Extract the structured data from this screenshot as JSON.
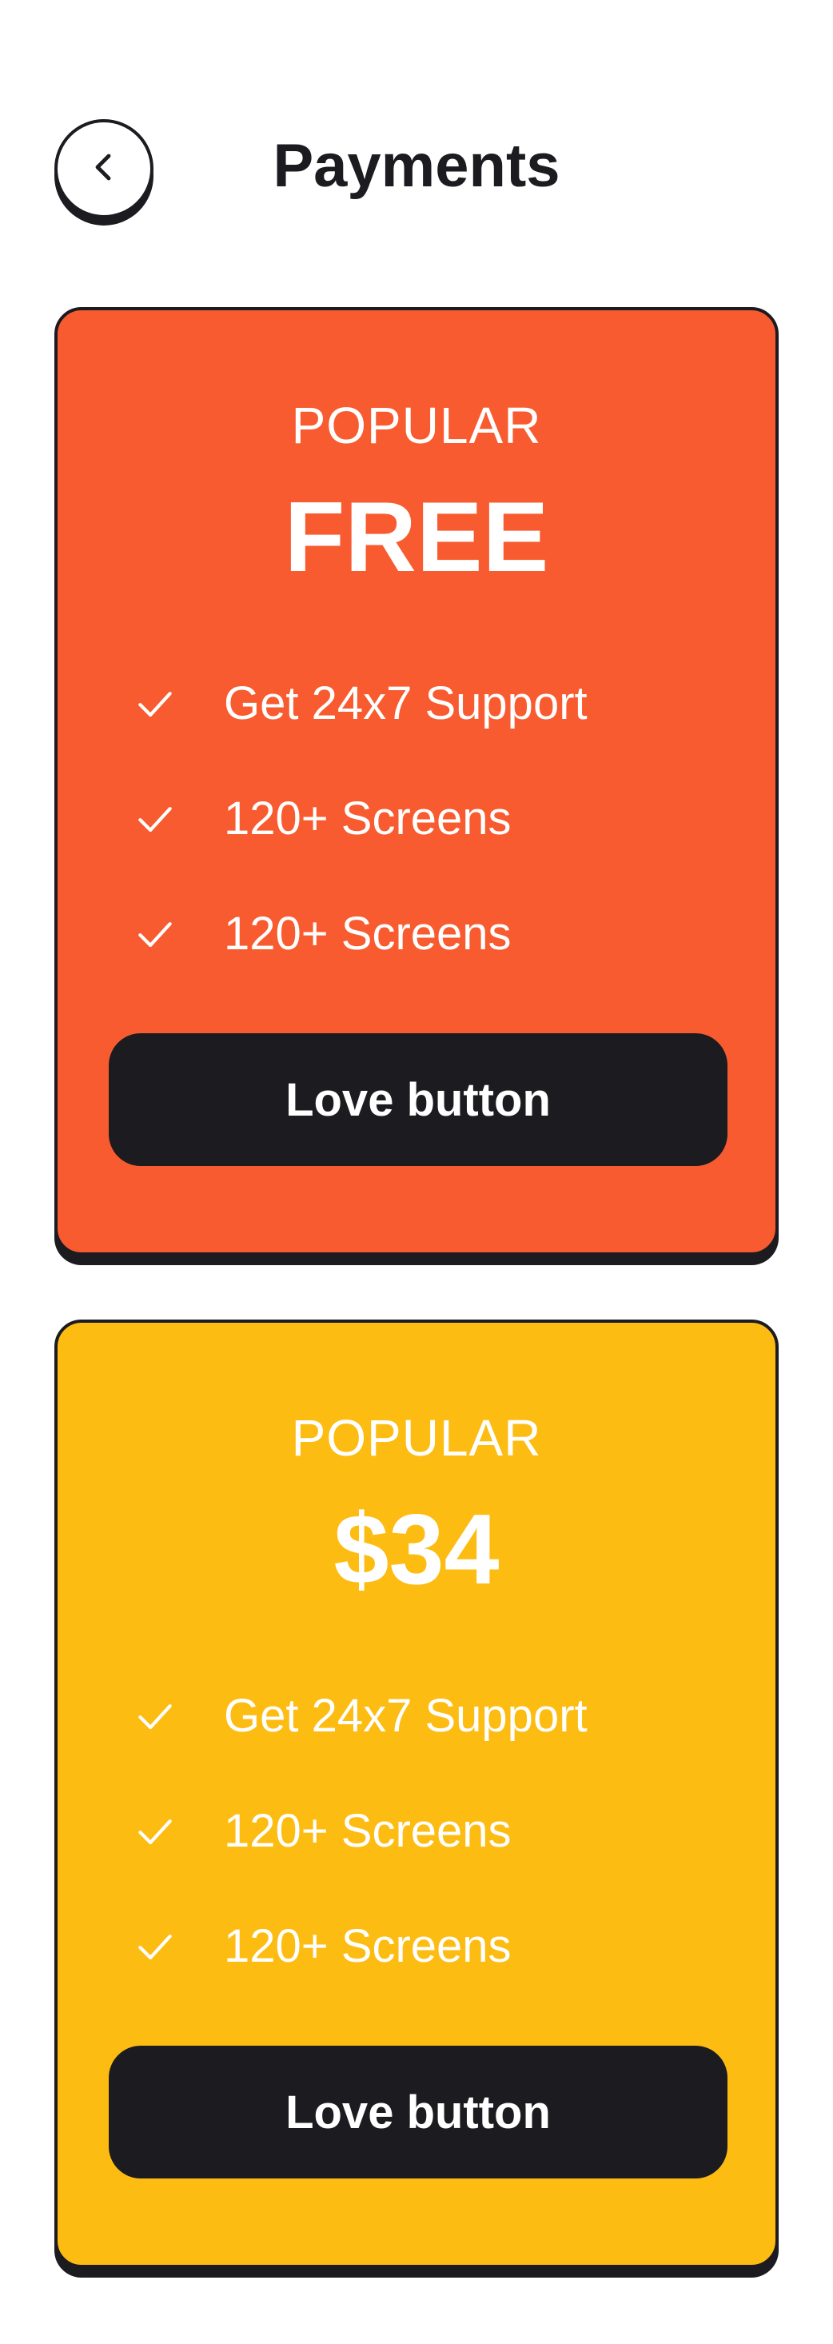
{
  "header": {
    "title": "Payments",
    "back_icon": "chevron-left-icon"
  },
  "plans": [
    {
      "badge": "POPULAR",
      "price": "FREE",
      "color": "#f85b2f",
      "features": [
        "Get 24x7 Support",
        "120+ Screens",
        "120+ Screens"
      ],
      "button_label": "Love button"
    },
    {
      "badge": "POPULAR",
      "price": "$34",
      "color": "#fdbc12",
      "features": [
        "Get 24x7 Support",
        "120+ Screens",
        "120+ Screens"
      ],
      "button_label": "Love button"
    }
  ],
  "colors": {
    "dark": "#1b1b20",
    "text_on_card": "#ffffff",
    "background": "#ffffff"
  },
  "icons": {
    "check": "check-icon"
  }
}
